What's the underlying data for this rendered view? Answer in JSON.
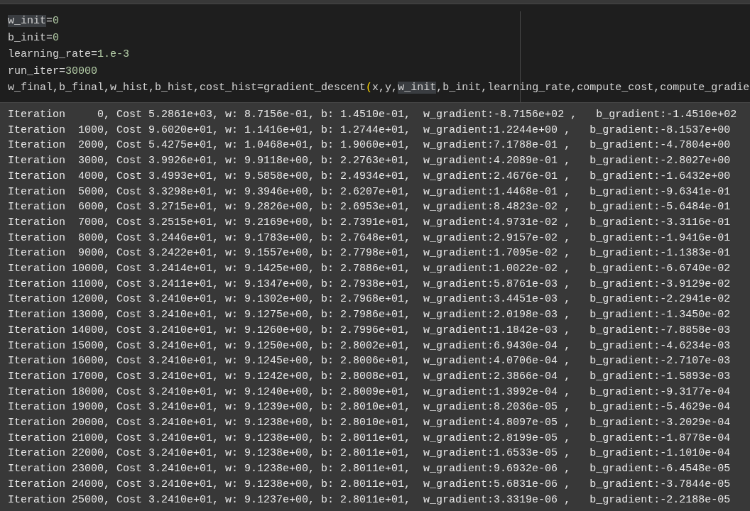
{
  "code_cell": {
    "lines": [
      [
        {
          "kind": "highlight",
          "text": "w_init"
        },
        {
          "kind": "plain",
          "text": "="
        },
        {
          "kind": "number",
          "text": "0"
        }
      ],
      [
        {
          "kind": "plain",
          "text": "b_init="
        },
        {
          "kind": "number",
          "text": "0"
        }
      ],
      [
        {
          "kind": "plain",
          "text": "learning_rate="
        },
        {
          "kind": "number",
          "text": "1.e-3"
        }
      ],
      [
        {
          "kind": "plain",
          "text": "run_iter="
        },
        {
          "kind": "number",
          "text": "30000"
        }
      ],
      [
        {
          "kind": "plain",
          "text": "w_final,b_final,w_hist,b_hist,cost_hist=gradient_descent"
        },
        {
          "kind": "bracket",
          "text": "("
        },
        {
          "kind": "plain",
          "text": "x,y,"
        },
        {
          "kind": "highlight",
          "text": "w_init"
        },
        {
          "kind": "plain",
          "text": ",b_init,learning_rate,compute_cost,compute_gradie"
        }
      ]
    ]
  },
  "output": {
    "lines": [
      "Iteration     0, Cost 5.2861e+03, w: 8.7156e-01, b: 1.4510e-01,  w_gradient:-8.7156e+02 ,   b_gradient:-1.4510e+02",
      "Iteration  1000, Cost 9.6020e+01, w: 1.1416e+01, b: 1.2744e+01,  w_gradient:1.2244e+00 ,   b_gradient:-8.1537e+00",
      "Iteration  2000, Cost 5.4275e+01, w: 1.0468e+01, b: 1.9060e+01,  w_gradient:7.1788e-01 ,   b_gradient:-4.7804e+00",
      "Iteration  3000, Cost 3.9926e+01, w: 9.9118e+00, b: 2.2763e+01,  w_gradient:4.2089e-01 ,   b_gradient:-2.8027e+00",
      "Iteration  4000, Cost 3.4993e+01, w: 9.5858e+00, b: 2.4934e+01,  w_gradient:2.4676e-01 ,   b_gradient:-1.6432e+00",
      "Iteration  5000, Cost 3.3298e+01, w: 9.3946e+00, b: 2.6207e+01,  w_gradient:1.4468e-01 ,   b_gradient:-9.6341e-01",
      "Iteration  6000, Cost 3.2715e+01, w: 9.2826e+00, b: 2.6953e+01,  w_gradient:8.4823e-02 ,   b_gradient:-5.6484e-01",
      "Iteration  7000, Cost 3.2515e+01, w: 9.2169e+00, b: 2.7391e+01,  w_gradient:4.9731e-02 ,   b_gradient:-3.3116e-01",
      "Iteration  8000, Cost 3.2446e+01, w: 9.1783e+00, b: 2.7648e+01,  w_gradient:2.9157e-02 ,   b_gradient:-1.9416e-01",
      "Iteration  9000, Cost 3.2422e+01, w: 9.1557e+00, b: 2.7798e+01,  w_gradient:1.7095e-02 ,   b_gradient:-1.1383e-01",
      "Iteration 10000, Cost 3.2414e+01, w: 9.1425e+00, b: 2.7886e+01,  w_gradient:1.0022e-02 ,   b_gradient:-6.6740e-02",
      "Iteration 11000, Cost 3.2411e+01, w: 9.1347e+00, b: 2.7938e+01,  w_gradient:5.8761e-03 ,   b_gradient:-3.9129e-02",
      "Iteration 12000, Cost 3.2410e+01, w: 9.1302e+00, b: 2.7968e+01,  w_gradient:3.4451e-03 ,   b_gradient:-2.2941e-02",
      "Iteration 13000, Cost 3.2410e+01, w: 9.1275e+00, b: 2.7986e+01,  w_gradient:2.0198e-03 ,   b_gradient:-1.3450e-02",
      "Iteration 14000, Cost 3.2410e+01, w: 9.1260e+00, b: 2.7996e+01,  w_gradient:1.1842e-03 ,   b_gradient:-7.8858e-03",
      "Iteration 15000, Cost 3.2410e+01, w: 9.1250e+00, b: 2.8002e+01,  w_gradient:6.9430e-04 ,   b_gradient:-4.6234e-03",
      "Iteration 16000, Cost 3.2410e+01, w: 9.1245e+00, b: 2.8006e+01,  w_gradient:4.0706e-04 ,   b_gradient:-2.7107e-03",
      "Iteration 17000, Cost 3.2410e+01, w: 9.1242e+00, b: 2.8008e+01,  w_gradient:2.3866e-04 ,   b_gradient:-1.5893e-03",
      "Iteration 18000, Cost 3.2410e+01, w: 9.1240e+00, b: 2.8009e+01,  w_gradient:1.3992e-04 ,   b_gradient:-9.3177e-04",
      "Iteration 19000, Cost 3.2410e+01, w: 9.1239e+00, b: 2.8010e+01,  w_gradient:8.2036e-05 ,   b_gradient:-5.4629e-04",
      "Iteration 20000, Cost 3.2410e+01, w: 9.1238e+00, b: 2.8010e+01,  w_gradient:4.8097e-05 ,   b_gradient:-3.2029e-04",
      "Iteration 21000, Cost 3.2410e+01, w: 9.1238e+00, b: 2.8011e+01,  w_gradient:2.8199e-05 ,   b_gradient:-1.8778e-04",
      "Iteration 22000, Cost 3.2410e+01, w: 9.1238e+00, b: 2.8011e+01,  w_gradient:1.6533e-05 ,   b_gradient:-1.1010e-04",
      "Iteration 23000, Cost 3.2410e+01, w: 9.1238e+00, b: 2.8011e+01,  w_gradient:9.6932e-06 ,   b_gradient:-6.4548e-05",
      "Iteration 24000, Cost 3.2410e+01, w: 9.1238e+00, b: 2.8011e+01,  w_gradient:5.6831e-06 ,   b_gradient:-3.7844e-05",
      "Iteration 25000, Cost 3.2410e+01, w: 9.1237e+00, b: 2.8011e+01,  w_gradient:3.3319e-06 ,   b_gradient:-2.2188e-05"
    ]
  }
}
